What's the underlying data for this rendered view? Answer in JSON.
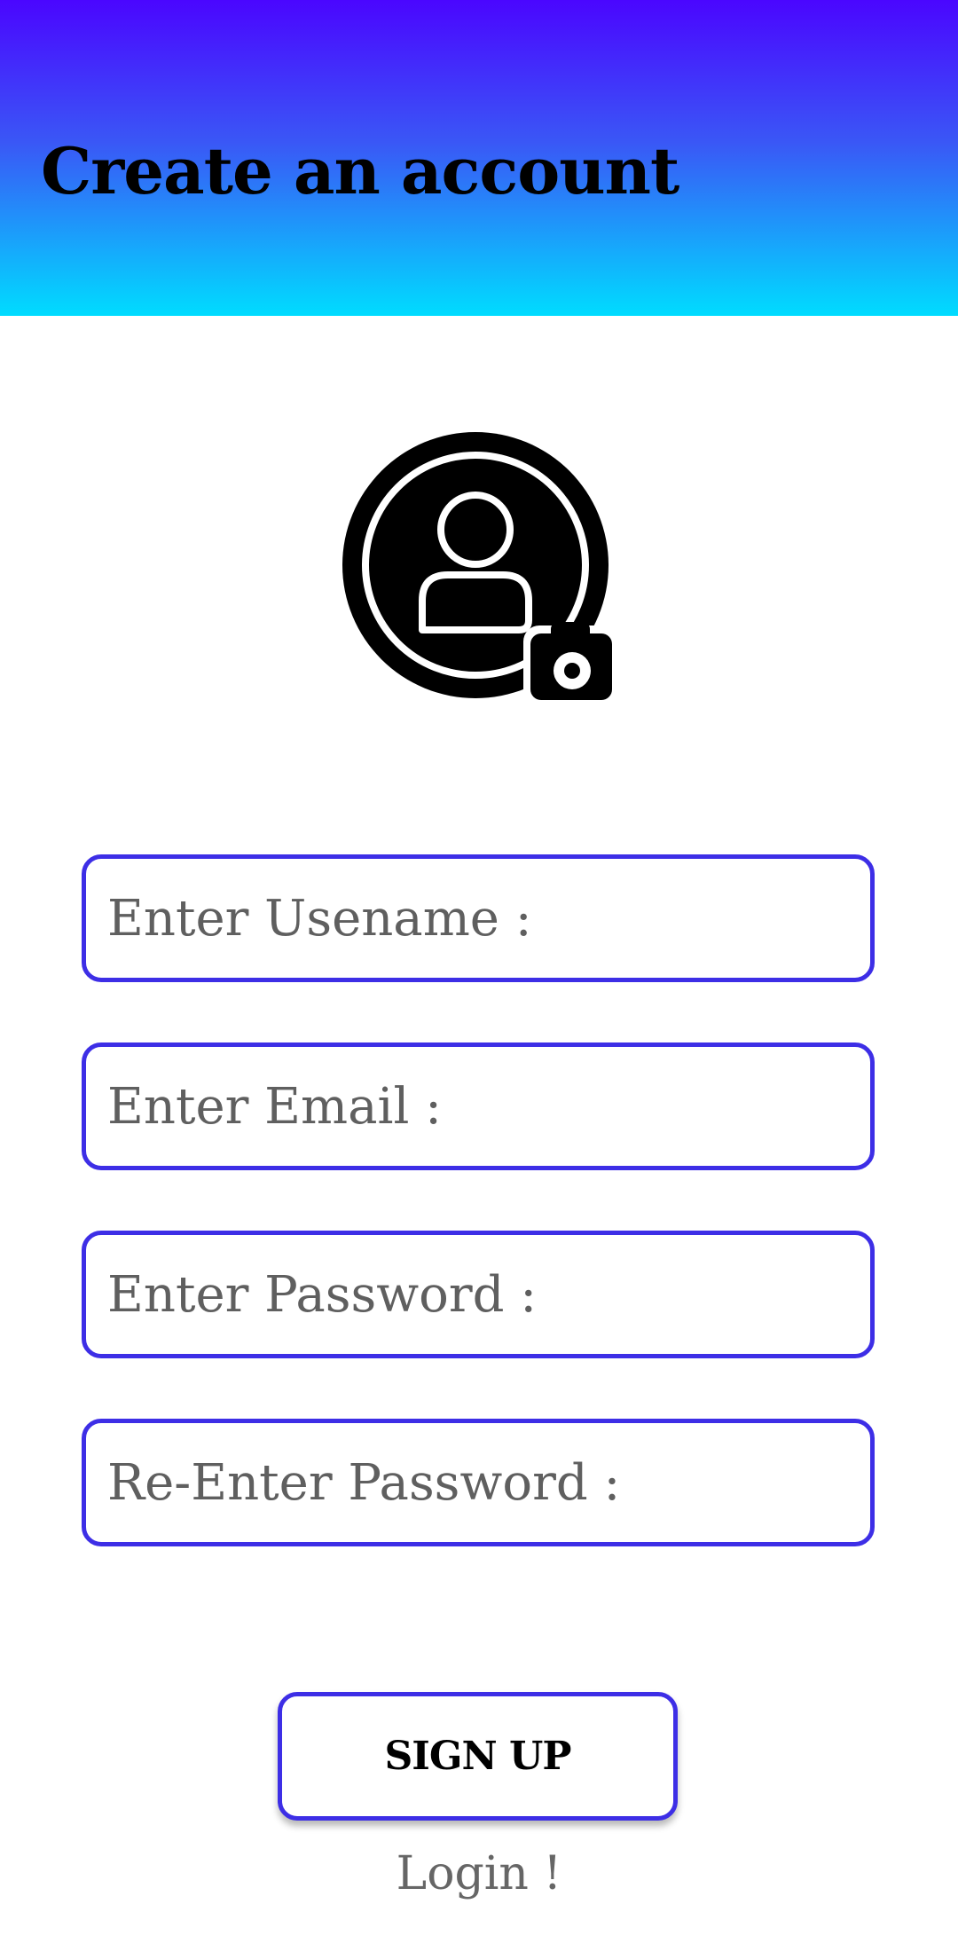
{
  "header": {
    "title": "Create an account",
    "gradient_top": "#4a06ff",
    "gradient_bottom": "#00dcff"
  },
  "avatar": {
    "icon": "user-circle-icon",
    "badge_icon": "camera-icon"
  },
  "form": {
    "username_placeholder": "Enter Usename :",
    "email_placeholder": "Enter Email :",
    "password_placeholder": "Enter Password :",
    "reenter_password_placeholder": "Re-Enter Password :",
    "border_color": "#3d2ee6"
  },
  "actions": {
    "signup_label": "SIGN UP",
    "login_label": "Login !"
  }
}
